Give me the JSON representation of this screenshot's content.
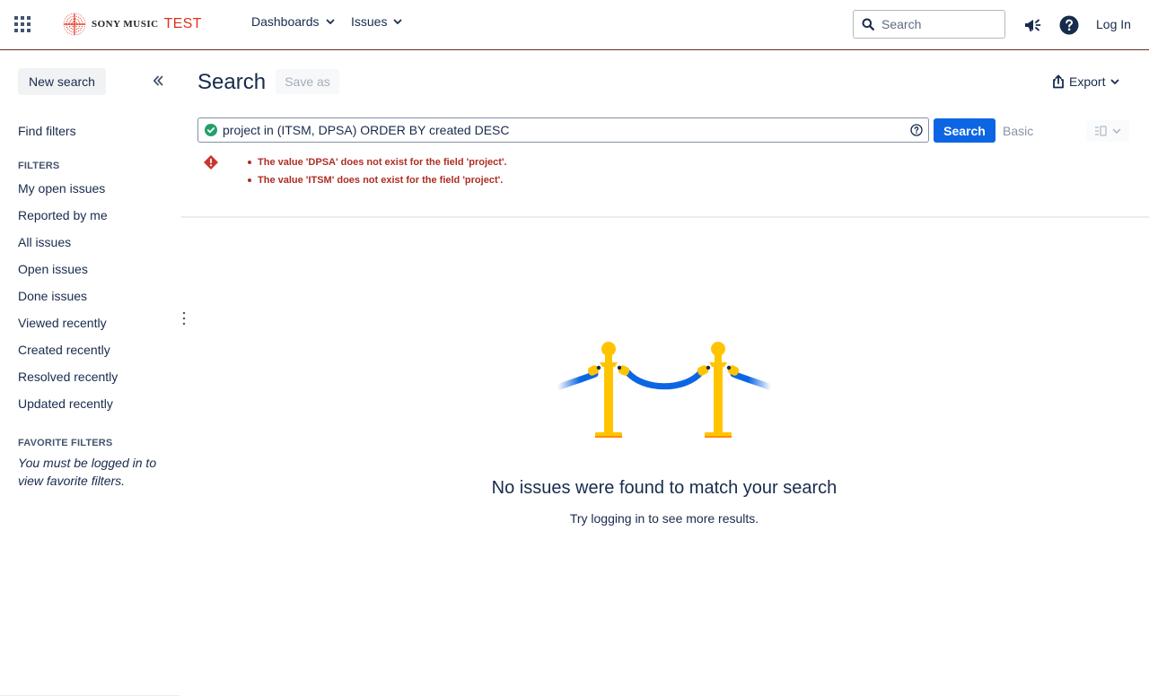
{
  "topnav": {
    "brand": "SONY MUSIC",
    "env": "TEST",
    "menus": [
      {
        "label": "Dashboards"
      },
      {
        "label": "Issues"
      }
    ],
    "search_placeholder": "Search",
    "login_label": "Log In",
    "icons": [
      "app-switcher-icon",
      "megaphone-icon",
      "help-icon",
      "search-icon"
    ]
  },
  "sidebar": {
    "new_search_label": "New search",
    "find_filters_label": "Find filters",
    "filters_heading": "FILTERS",
    "filters": [
      "My open issues",
      "Reported by me",
      "All issues",
      "Open issues",
      "Done issues",
      "Viewed recently",
      "Created recently",
      "Resolved recently",
      "Updated recently"
    ],
    "favorites_heading": "FAVORITE FILTERS",
    "favorites_note": "You must be logged in to view favorite filters."
  },
  "main": {
    "title": "Search",
    "save_as_label": "Save as",
    "export_label": "Export",
    "jql_query": "project in (ITSM, DPSA) ORDER BY created DESC",
    "search_button_label": "Search",
    "basic_label": "Basic",
    "errors": [
      "The value 'DPSA' does not exist for the field 'project'.",
      "The value 'ITSM' does not exist for the field 'project'."
    ],
    "empty_title": "No issues were found to match your search",
    "empty_subtitle": "Try logging in to see more results."
  },
  "colors": {
    "primary": "#0c66e4",
    "error": "#ae2e24",
    "valid": "#22a06b",
    "brand_env": "#e0301e",
    "post_gold": "#ffc400",
    "rope_blue": "#0c66e4"
  }
}
